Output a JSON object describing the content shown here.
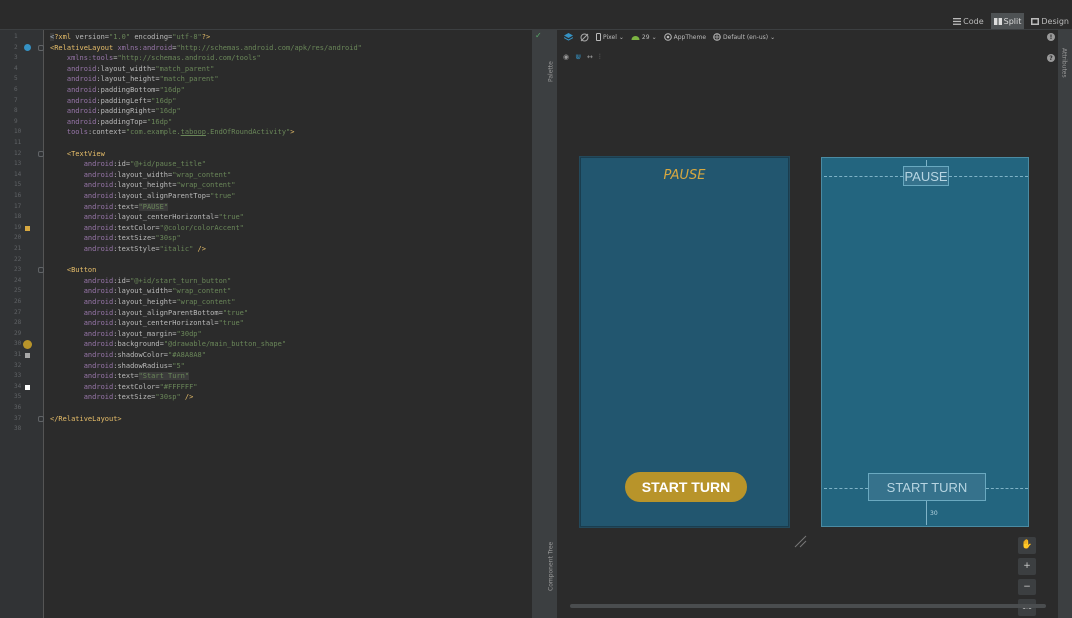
{
  "view_modes": {
    "code": "Code",
    "split": "Split",
    "design": "Design",
    "active": "split"
  },
  "editor": {
    "lines": [
      {
        "n": "1",
        "parts": [
          {
            "c": "t-txt t-hl",
            "t": "<"
          },
          {
            "c": "t-tag",
            "t": "?xml "
          },
          {
            "c": "t-attr",
            "t": "version="
          },
          {
            "c": "t-val",
            "t": "\"1.0\" "
          },
          {
            "c": "t-attr",
            "t": "encoding="
          },
          {
            "c": "t-val",
            "t": "\"utf-8\""
          },
          {
            "c": "t-tag",
            "t": "?>"
          }
        ]
      },
      {
        "n": "2",
        "parts": [
          {
            "c": "t-tag",
            "t": "<RelativeLayout "
          },
          {
            "c": "t-ns",
            "t": "xmlns:android"
          },
          {
            "c": "t-attr",
            "t": "="
          },
          {
            "c": "t-val",
            "t": "\"http://schemas.android.com/apk/res/android\""
          }
        ]
      },
      {
        "n": "3",
        "parts": [
          {
            "c": "t-txt",
            "t": "    "
          },
          {
            "c": "t-ns",
            "t": "xmlns:tools"
          },
          {
            "c": "t-attr",
            "t": "="
          },
          {
            "c": "t-val",
            "t": "\"http://schemas.android.com/tools\""
          }
        ]
      },
      {
        "n": "4",
        "parts": [
          {
            "c": "t-txt",
            "t": "    "
          },
          {
            "c": "t-ns",
            "t": "android"
          },
          {
            "c": "t-attr",
            "t": ":layout_width="
          },
          {
            "c": "t-val",
            "t": "\"match_parent\""
          }
        ]
      },
      {
        "n": "5",
        "parts": [
          {
            "c": "t-txt",
            "t": "    "
          },
          {
            "c": "t-ns",
            "t": "android"
          },
          {
            "c": "t-attr",
            "t": ":layout_height="
          },
          {
            "c": "t-val",
            "t": "\"match_parent\""
          }
        ]
      },
      {
        "n": "6",
        "parts": [
          {
            "c": "t-txt",
            "t": "    "
          },
          {
            "c": "t-ns",
            "t": "android"
          },
          {
            "c": "t-attr",
            "t": ":paddingBottom="
          },
          {
            "c": "t-val",
            "t": "\"16dp\""
          }
        ]
      },
      {
        "n": "7",
        "parts": [
          {
            "c": "t-txt",
            "t": "    "
          },
          {
            "c": "t-ns",
            "t": "android"
          },
          {
            "c": "t-attr",
            "t": ":paddingLeft="
          },
          {
            "c": "t-val",
            "t": "\"16dp\""
          }
        ]
      },
      {
        "n": "8",
        "parts": [
          {
            "c": "t-txt",
            "t": "    "
          },
          {
            "c": "t-ns",
            "t": "android"
          },
          {
            "c": "t-attr",
            "t": ":paddingRight="
          },
          {
            "c": "t-val",
            "t": "\"16dp\""
          }
        ]
      },
      {
        "n": "9",
        "parts": [
          {
            "c": "t-txt",
            "t": "    "
          },
          {
            "c": "t-ns",
            "t": "android"
          },
          {
            "c": "t-attr",
            "t": ":paddingTop="
          },
          {
            "c": "t-val",
            "t": "\"16dp\""
          }
        ]
      },
      {
        "n": "10",
        "parts": [
          {
            "c": "t-txt",
            "t": "    "
          },
          {
            "c": "t-ns",
            "t": "tools"
          },
          {
            "c": "t-attr",
            "t": ":context="
          },
          {
            "c": "t-val",
            "t": "\"com.example."
          },
          {
            "c": "t-val t-und",
            "t": "taboop"
          },
          {
            "c": "t-val",
            "t": ".EndOfRoundActivity\""
          },
          {
            "c": "t-tag",
            "t": ">"
          }
        ]
      },
      {
        "n": "11",
        "parts": []
      },
      {
        "n": "12",
        "parts": [
          {
            "c": "t-txt",
            "t": "    "
          },
          {
            "c": "t-tag",
            "t": "<TextView"
          }
        ]
      },
      {
        "n": "13",
        "parts": [
          {
            "c": "t-txt",
            "t": "        "
          },
          {
            "c": "t-ns",
            "t": "android"
          },
          {
            "c": "t-attr",
            "t": ":id="
          },
          {
            "c": "t-val",
            "t": "\"@+id/pause_title\""
          }
        ]
      },
      {
        "n": "14",
        "parts": [
          {
            "c": "t-txt",
            "t": "        "
          },
          {
            "c": "t-ns",
            "t": "android"
          },
          {
            "c": "t-attr",
            "t": ":layout_width="
          },
          {
            "c": "t-val",
            "t": "\"wrap_content\""
          }
        ]
      },
      {
        "n": "15",
        "parts": [
          {
            "c": "t-txt",
            "t": "        "
          },
          {
            "c": "t-ns",
            "t": "android"
          },
          {
            "c": "t-attr",
            "t": ":layout_height="
          },
          {
            "c": "t-val",
            "t": "\"wrap_content\""
          }
        ]
      },
      {
        "n": "16",
        "parts": [
          {
            "c": "t-txt",
            "t": "        "
          },
          {
            "c": "t-ns",
            "t": "android"
          },
          {
            "c": "t-attr",
            "t": ":layout_alignParentTop="
          },
          {
            "c": "t-val",
            "t": "\"true\""
          }
        ]
      },
      {
        "n": "17",
        "parts": [
          {
            "c": "t-txt",
            "t": "        "
          },
          {
            "c": "t-ns",
            "t": "android"
          },
          {
            "c": "t-attr",
            "t": ":text="
          },
          {
            "c": "t-val t-hl",
            "t": "\"PAUSE\""
          }
        ]
      },
      {
        "n": "18",
        "parts": [
          {
            "c": "t-txt",
            "t": "        "
          },
          {
            "c": "t-ns",
            "t": "android"
          },
          {
            "c": "t-attr",
            "t": ":layout_centerHorizontal="
          },
          {
            "c": "t-val",
            "t": "\"true\""
          }
        ]
      },
      {
        "n": "19",
        "parts": [
          {
            "c": "t-txt",
            "t": "        "
          },
          {
            "c": "t-ns",
            "t": "android"
          },
          {
            "c": "t-attr",
            "t": ":textColor="
          },
          {
            "c": "t-val",
            "t": "\"@color/colorAccent\""
          }
        ]
      },
      {
        "n": "20",
        "parts": [
          {
            "c": "t-txt",
            "t": "        "
          },
          {
            "c": "t-ns",
            "t": "android"
          },
          {
            "c": "t-attr",
            "t": ":textSize="
          },
          {
            "c": "t-val",
            "t": "\"30sp\""
          }
        ]
      },
      {
        "n": "21",
        "parts": [
          {
            "c": "t-txt",
            "t": "        "
          },
          {
            "c": "t-ns",
            "t": "android"
          },
          {
            "c": "t-attr",
            "t": ":textStyle="
          },
          {
            "c": "t-val",
            "t": "\"italic\" "
          },
          {
            "c": "t-tag",
            "t": "/>"
          }
        ]
      },
      {
        "n": "22",
        "parts": []
      },
      {
        "n": "23",
        "parts": [
          {
            "c": "t-txt",
            "t": "    "
          },
          {
            "c": "t-tag",
            "t": "<Button"
          }
        ]
      },
      {
        "n": "24",
        "parts": [
          {
            "c": "t-txt",
            "t": "        "
          },
          {
            "c": "t-ns",
            "t": "android"
          },
          {
            "c": "t-attr",
            "t": ":id="
          },
          {
            "c": "t-val",
            "t": "\"@+id/start_turn_button\""
          }
        ]
      },
      {
        "n": "25",
        "parts": [
          {
            "c": "t-txt",
            "t": "        "
          },
          {
            "c": "t-ns",
            "t": "android"
          },
          {
            "c": "t-attr",
            "t": ":layout_width="
          },
          {
            "c": "t-val",
            "t": "\"wrap_content\""
          }
        ]
      },
      {
        "n": "26",
        "parts": [
          {
            "c": "t-txt",
            "t": "        "
          },
          {
            "c": "t-ns",
            "t": "android"
          },
          {
            "c": "t-attr",
            "t": ":layout_height="
          },
          {
            "c": "t-val",
            "t": "\"wrap_content\""
          }
        ]
      },
      {
        "n": "27",
        "parts": [
          {
            "c": "t-txt",
            "t": "        "
          },
          {
            "c": "t-ns",
            "t": "android"
          },
          {
            "c": "t-attr",
            "t": ":layout_alignParentBottom="
          },
          {
            "c": "t-val",
            "t": "\"true\""
          }
        ]
      },
      {
        "n": "28",
        "parts": [
          {
            "c": "t-txt",
            "t": "        "
          },
          {
            "c": "t-ns",
            "t": "android"
          },
          {
            "c": "t-attr",
            "t": ":layout_centerHorizontal="
          },
          {
            "c": "t-val",
            "t": "\"true\""
          }
        ]
      },
      {
        "n": "29",
        "parts": [
          {
            "c": "t-txt",
            "t": "        "
          },
          {
            "c": "t-ns",
            "t": "android"
          },
          {
            "c": "t-attr",
            "t": ":layout_margin="
          },
          {
            "c": "t-val",
            "t": "\"30dp\""
          }
        ]
      },
      {
        "n": "30",
        "parts": [
          {
            "c": "t-txt",
            "t": "        "
          },
          {
            "c": "t-ns",
            "t": "android"
          },
          {
            "c": "t-attr",
            "t": ":background="
          },
          {
            "c": "t-val",
            "t": "\"@drawable/main_button_shape\""
          }
        ]
      },
      {
        "n": "31",
        "parts": [
          {
            "c": "t-txt",
            "t": "        "
          },
          {
            "c": "t-ns",
            "t": "android"
          },
          {
            "c": "t-attr",
            "t": ":shadowColor="
          },
          {
            "c": "t-val",
            "t": "\"#A8A8A8\""
          }
        ]
      },
      {
        "n": "32",
        "parts": [
          {
            "c": "t-txt",
            "t": "        "
          },
          {
            "c": "t-ns",
            "t": "android"
          },
          {
            "c": "t-attr",
            "t": ":shadowRadius="
          },
          {
            "c": "t-val",
            "t": "\"5\""
          }
        ]
      },
      {
        "n": "33",
        "parts": [
          {
            "c": "t-txt",
            "t": "        "
          },
          {
            "c": "t-ns",
            "t": "android"
          },
          {
            "c": "t-attr",
            "t": ":text="
          },
          {
            "c": "t-val t-hl",
            "t": "\"Start Turn\""
          }
        ]
      },
      {
        "n": "34",
        "parts": [
          {
            "c": "t-txt",
            "t": "        "
          },
          {
            "c": "t-ns",
            "t": "android"
          },
          {
            "c": "t-attr",
            "t": ":textColor="
          },
          {
            "c": "t-val",
            "t": "\"#FFFFFF\""
          }
        ]
      },
      {
        "n": "35",
        "parts": [
          {
            "c": "t-txt",
            "t": "        "
          },
          {
            "c": "t-ns",
            "t": "android"
          },
          {
            "c": "t-attr",
            "t": ":textSize="
          },
          {
            "c": "t-val",
            "t": "\"30sp\" "
          },
          {
            "c": "t-tag",
            "t": "/>"
          }
        ]
      },
      {
        "n": "36",
        "parts": []
      },
      {
        "n": "37",
        "parts": [
          {
            "c": "t-tag",
            "t": "</RelativeLayout>"
          }
        ]
      },
      {
        "n": "38",
        "parts": []
      }
    ],
    "gutter_markers": [
      {
        "line": 2,
        "type": "circle",
        "color": "#3592c4"
      },
      {
        "line": 19,
        "type": "square",
        "color": "#d7a840"
      },
      {
        "line": 30,
        "type": "circle",
        "color": "#b8942a"
      },
      {
        "line": 31,
        "type": "square",
        "color": "#a8a8a8"
      },
      {
        "line": 34,
        "type": "square",
        "color": "#ffffff"
      }
    ]
  },
  "design_toolbar": {
    "device": "Pixel",
    "api": "29",
    "theme": "AppTheme",
    "locale": "Default (en-us)"
  },
  "side_tabs": {
    "palette": "Palette",
    "component_tree": "Component Tree",
    "attributes": "Attributes"
  },
  "preview": {
    "title": "PAUSE",
    "button": "START TURN",
    "margin_label": "30",
    "title_color": "#d7a840",
    "button_color": "#b8942a",
    "background": "#22566f"
  },
  "zoom": {
    "one_to_one": "1:1"
  }
}
